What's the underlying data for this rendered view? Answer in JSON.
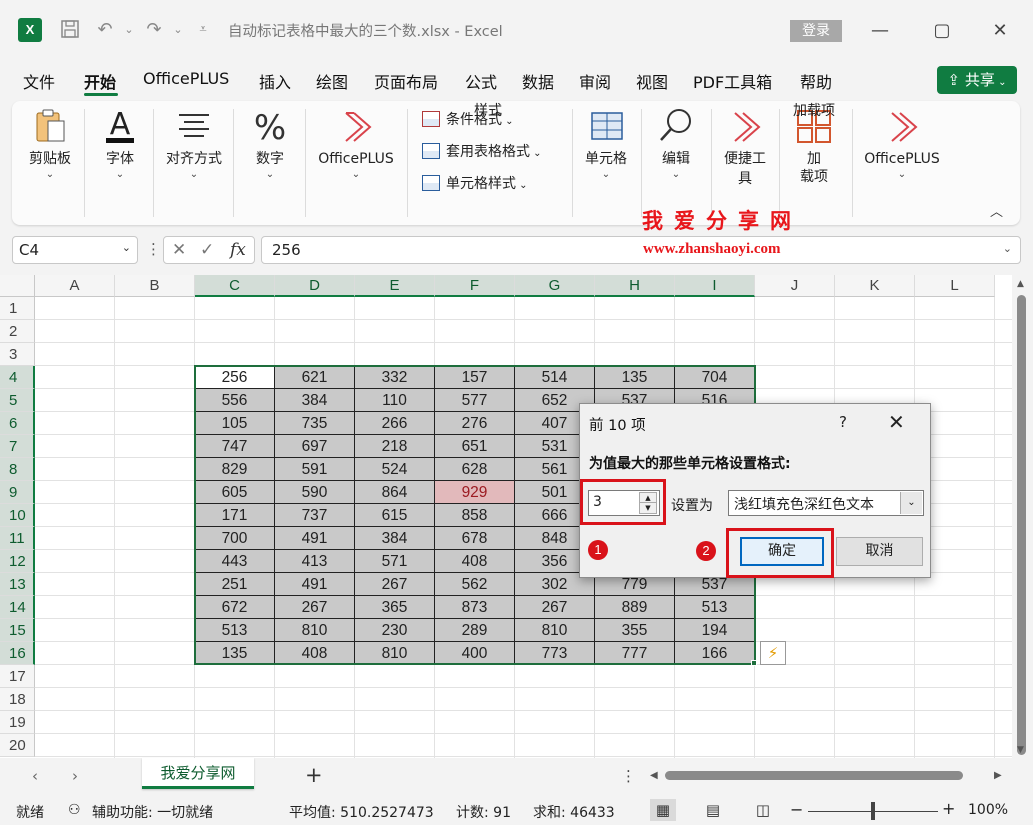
{
  "titlebar": {
    "app_icon": "excel-logo",
    "app_letter": "X",
    "doc_title": "自动标记表格中最大的三个数.xlsx  -  Excel",
    "login_label": "登录",
    "icons": [
      "save-icon",
      "undo-icon",
      "redo-icon",
      "customize-icon",
      "minimize-icon",
      "maximize-icon",
      "close-icon"
    ]
  },
  "menu": {
    "items": [
      "文件",
      "开始",
      "OfficePLUS",
      "插入",
      "绘图",
      "页面布局",
      "公式",
      "数据",
      "审阅",
      "视图",
      "PDF工具箱",
      "帮助"
    ],
    "active": "开始",
    "share_label": "共享"
  },
  "ribbon": {
    "clipboard": "剪贴板",
    "font": "字体",
    "align": "对齐方式",
    "number": "数字",
    "officeplus": "OfficePLUS",
    "cond_format": "条件格式",
    "table_format": "套用表格格式",
    "cell_style": "单元格样式",
    "styles_group": "样式",
    "cells": "单元格",
    "edit": "编辑",
    "quick_tools": "便捷工具",
    "addin_line1": "加",
    "addin_line2": "载项",
    "addin_group": "加载项",
    "officeplus2": "OfficePLUS"
  },
  "formula_bar": {
    "name_box": "C4",
    "fx": "fx",
    "value": "256"
  },
  "watermark": {
    "cn": "我爱分享网",
    "url": "www.zhanshaoyi.com"
  },
  "grid": {
    "columns": [
      "A",
      "B",
      "C",
      "D",
      "E",
      "F",
      "G",
      "H",
      "I",
      "J",
      "K",
      "L"
    ],
    "selected_columns": [
      "C",
      "D",
      "E",
      "F",
      "G",
      "H",
      "I"
    ],
    "rows": [
      "1",
      "2",
      "3",
      "4",
      "5",
      "6",
      "7",
      "8",
      "9",
      "10",
      "11",
      "12",
      "13",
      "14",
      "15",
      "16",
      "17",
      "18",
      "19",
      "20"
    ],
    "selected_rows": [
      "4",
      "5",
      "6",
      "7",
      "8",
      "9",
      "10",
      "11",
      "12",
      "13",
      "14",
      "15",
      "16"
    ],
    "data_start_row": 4,
    "data": [
      [
        "256",
        "621",
        "332",
        "157",
        "514",
        "135",
        "704"
      ],
      [
        "556",
        "384",
        "110",
        "577",
        "652",
        "537",
        "516"
      ],
      [
        "105",
        "735",
        "266",
        "276",
        "407",
        "",
        ""
      ],
      [
        "747",
        "697",
        "218",
        "651",
        "531",
        "",
        ""
      ],
      [
        "829",
        "591",
        "524",
        "628",
        "561",
        "",
        ""
      ],
      [
        "605",
        "590",
        "864",
        "929",
        "501",
        "",
        ""
      ],
      [
        "171",
        "737",
        "615",
        "858",
        "666",
        "",
        ""
      ],
      [
        "700",
        "491",
        "384",
        "678",
        "848",
        "",
        ""
      ],
      [
        "443",
        "413",
        "571",
        "408",
        "356",
        "",
        ""
      ],
      [
        "251",
        "491",
        "267",
        "562",
        "302",
        "779",
        "537"
      ],
      [
        "672",
        "267",
        "365",
        "873",
        "267",
        "889",
        "513"
      ],
      [
        "513",
        "810",
        "230",
        "289",
        "810",
        "355",
        "194"
      ],
      [
        "135",
        "408",
        "810",
        "400",
        "773",
        "777",
        "166"
      ]
    ],
    "highlighted_cell": {
      "row": 9,
      "col": "F"
    },
    "colors": {
      "selection_fill": "#c9c9c9",
      "highlight_fill": "#e2b9bb",
      "highlight_text": "#9c1b22",
      "accent": "#107c41"
    }
  },
  "dialog": {
    "title": "前 10 项",
    "help": "?",
    "prompt": "为值最大的那些单元格设置格式:",
    "count": "3",
    "set_as_label": "设置为",
    "format_option": "浅红填充色深红色文本",
    "ok_label": "确定",
    "cancel_label": "取消",
    "badge1": "1",
    "badge2": "2"
  },
  "sheet_tabs": {
    "active": "我爱分享网",
    "add": "+"
  },
  "status": {
    "ready": "就绪",
    "accessibility": "辅助功能: 一切就绪",
    "average": "平均值: 510.2527473",
    "count": "计数: 91",
    "sum": "求和: 46433",
    "zoom": "100%"
  }
}
